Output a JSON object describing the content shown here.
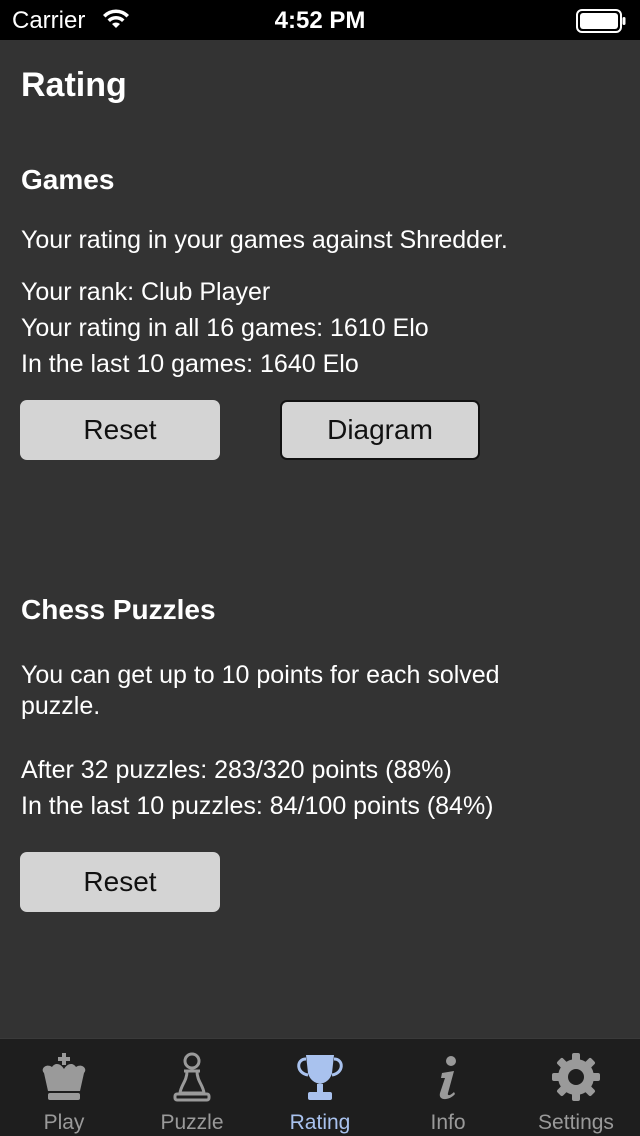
{
  "status_bar": {
    "carrier": "Carrier",
    "time": "4:52 PM"
  },
  "page": {
    "title": "Rating"
  },
  "games": {
    "title": "Games",
    "description": "Your rating in your games against Shredder.",
    "rank": "Your rank: Club Player",
    "rating_all": "Your rating in all 16 games: 1610 Elo",
    "rating_last": "In the last 10 games: 1640 Elo",
    "reset_label": "Reset",
    "diagram_label": "Diagram"
  },
  "puzzles": {
    "title": "Chess Puzzles",
    "description": "You can get up to 10 points for each solved puzzle.",
    "after": "After 32 puzzles: 283/320 points (88%)",
    "last": "In the last 10 puzzles: 84/100 points (84%)",
    "reset_label": "Reset"
  },
  "tab_bar": {
    "tabs": [
      {
        "label": "Play",
        "icon": "king-icon"
      },
      {
        "label": "Puzzle",
        "icon": "pawn-icon"
      },
      {
        "label": "Rating",
        "icon": "trophy-icon",
        "active": true
      },
      {
        "label": "Info",
        "icon": "info-icon"
      },
      {
        "label": "Settings",
        "icon": "gear-icon"
      }
    ]
  },
  "colors": {
    "background": "#333333",
    "button": "#d4d4d4",
    "tab_active": "#a9c2ee",
    "tab_inactive": "#9a9a9a"
  }
}
